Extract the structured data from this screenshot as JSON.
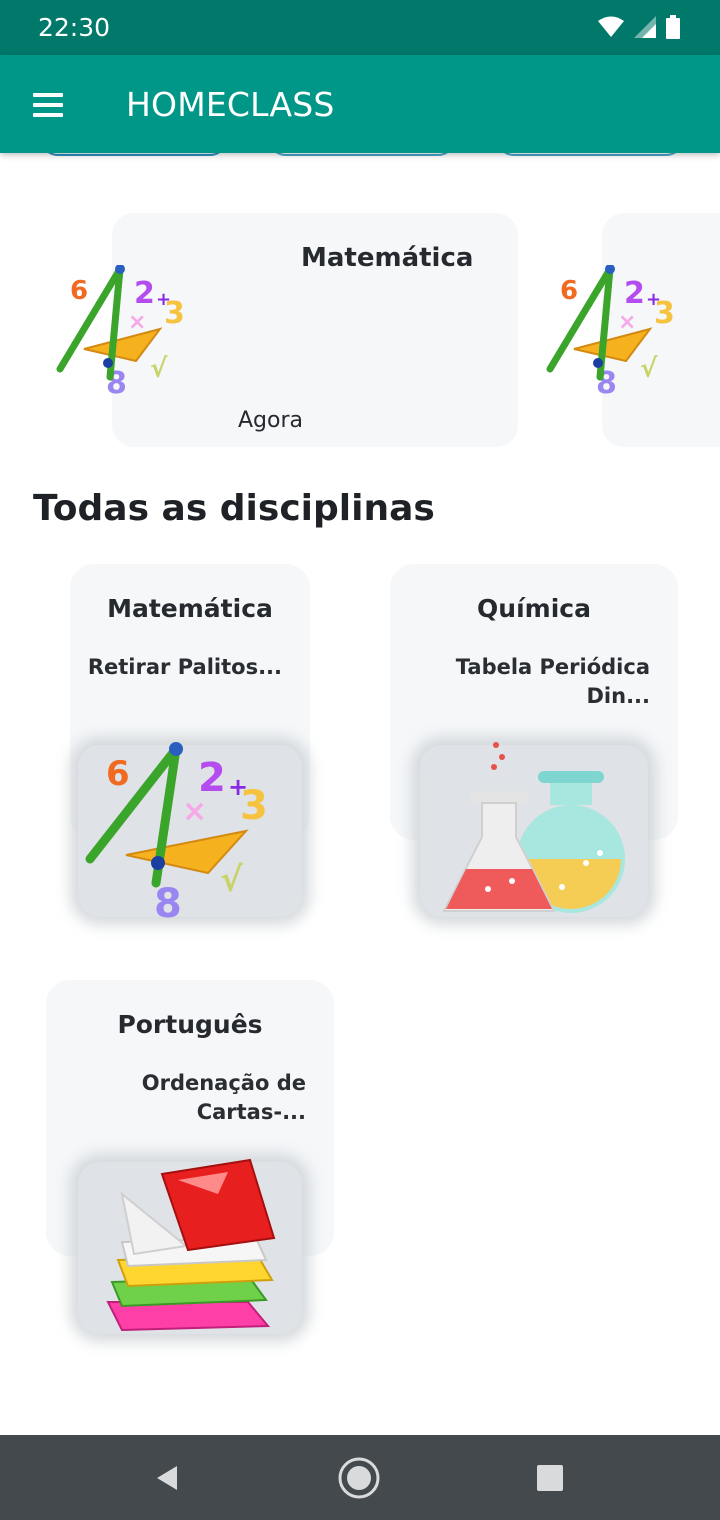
{
  "status_bar": {
    "time": "22:30",
    "icons": [
      "wifi-icon",
      "cell-signal-icon",
      "battery-icon"
    ]
  },
  "app_bar": {
    "title": "HOMECLASS",
    "menu_icon": "menu-icon"
  },
  "recent": [
    {
      "subject": "Matemática",
      "time": "Agora",
      "image": "math-illustration"
    },
    {
      "subject": "",
      "time": "",
      "image": "math-illustration"
    }
  ],
  "section_title": "Todas as disciplinas",
  "subjects": [
    {
      "name": "Matemática",
      "activity": "Retirar Palitos...",
      "image": "math-illustration"
    },
    {
      "name": "Química",
      "activity": "Tabela Periódica Din...",
      "image": "chemistry-flasks"
    },
    {
      "name": "Português",
      "activity": "Ordenação de Cartas-...",
      "image": "books-stack"
    }
  ],
  "colors": {
    "status_bar": "#00796b",
    "app_bar": "#009688",
    "card_bg": "#f5f7f9",
    "nav_bar": "#44494e"
  },
  "nav_bar": {
    "buttons": [
      "back-icon",
      "home-icon",
      "recents-icon"
    ]
  }
}
